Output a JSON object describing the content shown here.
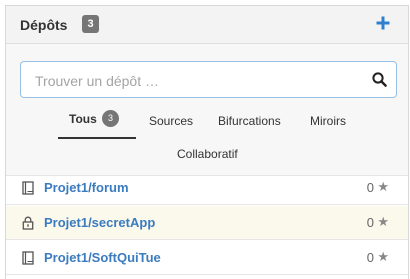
{
  "header": {
    "title": "Dépôts",
    "count": "3",
    "add_icon": "plus-icon"
  },
  "search": {
    "placeholder": "Trouver un dépôt …",
    "value": "",
    "icon": "search-icon"
  },
  "tabs": [
    {
      "label": "Tous",
      "badge": "3",
      "active": true
    },
    {
      "label": "Sources"
    },
    {
      "label": "Bifurcations"
    },
    {
      "label": "Miroirs"
    },
    {
      "label": "Collaboratif"
    }
  ],
  "repos": [
    {
      "name": "Projet1/forum",
      "stars": "0",
      "icon": "book-icon",
      "private": false
    },
    {
      "name": "Projet1/secretApp",
      "stars": "0",
      "icon": "lock-icon",
      "private": true
    },
    {
      "name": "Projet1/SoftQuiTue",
      "stars": "0",
      "icon": "book-icon",
      "private": false
    }
  ],
  "colors": {
    "accent": "#2f7fcf",
    "link": "#3b7bbf",
    "badge": "#767676",
    "private_row_bg": "#fbf8ec"
  }
}
